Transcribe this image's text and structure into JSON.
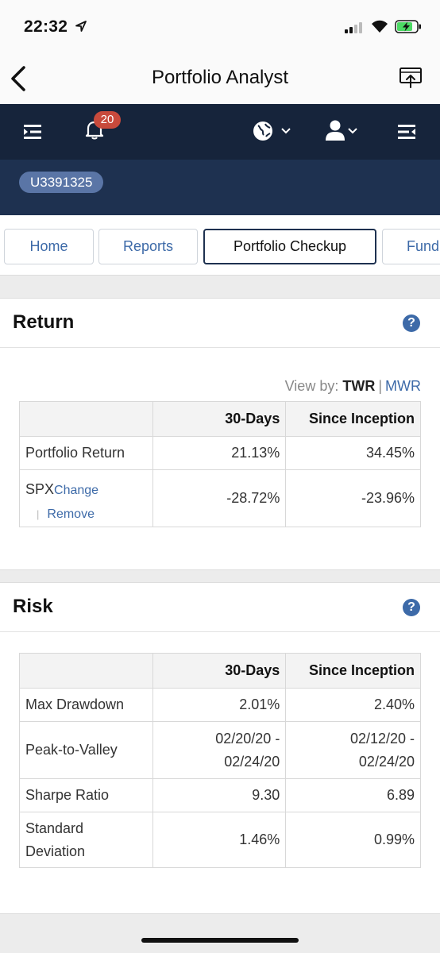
{
  "status": {
    "time": "22:32"
  },
  "nav": {
    "title": "Portfolio Analyst"
  },
  "topbar": {
    "notifications": "20"
  },
  "account": {
    "id": "U3391325"
  },
  "tabs": [
    {
      "label": "Home"
    },
    {
      "label": "Reports"
    },
    {
      "label": "Portfolio Checkup"
    },
    {
      "label": "Fund"
    }
  ],
  "return_card": {
    "title": "Return",
    "help": "?",
    "view_by": {
      "label": "View by:",
      "selected": "TWR",
      "other": "MWR"
    },
    "columns": [
      "",
      "30-Days",
      "Since Inception"
    ],
    "rows": [
      {
        "label": "Portfolio Return",
        "d30": "21.13%",
        "inception": "34.45%"
      },
      {
        "label": "SPX",
        "change": "Change",
        "remove": "Remove",
        "d30": "-28.72%",
        "inception": "-23.96%"
      }
    ]
  },
  "risk_card": {
    "title": "Risk",
    "help": "?",
    "columns": [
      "",
      "30-Days",
      "Since Inception"
    ],
    "rows": [
      {
        "label": "Max Drawdown",
        "d30": "2.01%",
        "inception": "2.40%"
      },
      {
        "label": "Peak-to-Valley",
        "d30_a": "02/20/20 -",
        "d30_b": "02/24/20",
        "inc_a": "02/12/20 -",
        "inc_b": "02/24/20"
      },
      {
        "label": "Sharpe Ratio",
        "d30": "9.30",
        "inception": "6.89"
      },
      {
        "label_a": "Standard",
        "label_b": "Deviation",
        "d30": "1.46%",
        "inception": "0.99%"
      }
    ]
  },
  "colors": {
    "nav_dark": "#16243b",
    "band": "#1e3150",
    "accent": "#3d6aa8",
    "badge": "#c84a3c"
  }
}
